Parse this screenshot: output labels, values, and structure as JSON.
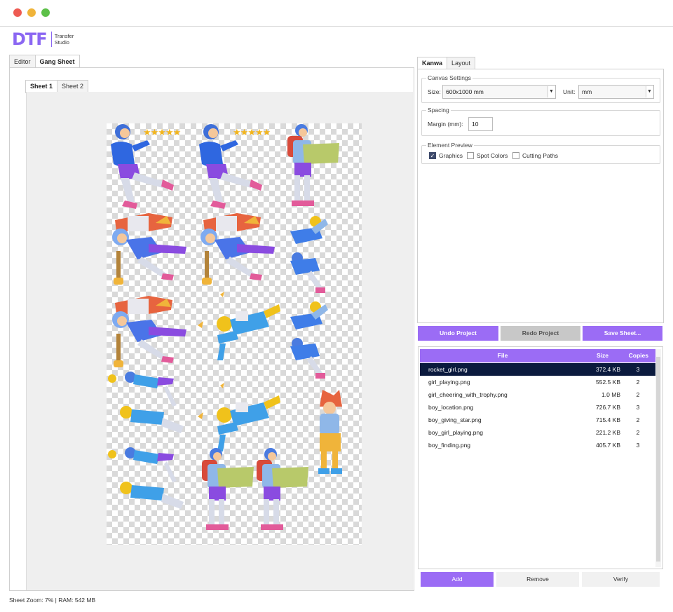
{
  "window": {
    "controls": [
      {
        "name": "close",
        "color": "#ee5b52"
      },
      {
        "name": "minimize",
        "color": "#f0b43a"
      },
      {
        "name": "maximize",
        "color": "#5cc048"
      }
    ]
  },
  "logo": {
    "mark": "DTF",
    "sub_line1": "Transfer",
    "sub_line2": "Studio",
    "color": "#8b67f2"
  },
  "main_tabs": [
    {
      "label": "Editor"
    },
    {
      "label": "Gang Sheet",
      "active": true
    }
  ],
  "sheet_tabs": [
    {
      "label": "Sheet 1",
      "active": true
    },
    {
      "label": "Sheet 2"
    }
  ],
  "canvas": {
    "stars": "★★★★★",
    "figures": [
      "boy-giving-star",
      "boy-giving-star",
      "boy-location",
      "rocket-girl",
      "rocket-girl",
      "girl-playing",
      "rocket-girl",
      "boy-finding",
      "girl-playing",
      "boy-girl-playing",
      "boy-finding",
      "girl-cheering-with-trophy",
      "boy-girl-playing",
      "boy-location",
      "boy-location",
      "rocket-girl"
    ]
  },
  "right_tabs": [
    {
      "label": "Kanwa",
      "active": true
    },
    {
      "label": "Layout"
    }
  ],
  "canvas_settings": {
    "title": "Canvas Settings",
    "size_label": "Size:",
    "size_value": "600x1000 mm",
    "unit_label": "Unit:",
    "unit_value": "mm"
  },
  "spacing": {
    "title": "Spacing",
    "margin_label": "Margin (mm):",
    "margin_value": "10"
  },
  "element_preview": {
    "title": "Element Preview",
    "options": [
      {
        "label": "Graphics",
        "checked": true
      },
      {
        "label": "Spot Colors",
        "checked": false
      },
      {
        "label": "Cutting Paths",
        "checked": false
      }
    ]
  },
  "actions": {
    "undo": "Undo Project",
    "redo": "Redo Project",
    "save": "Save Sheet..."
  },
  "file_list": {
    "headers": {
      "file": "File",
      "size": "Size",
      "copies": "Copies"
    },
    "rows": [
      {
        "file": "rocket_girl.png",
        "size": "372.4 KB",
        "copies": "3",
        "selected": true
      },
      {
        "file": "girl_playing.png",
        "size": "552.5 KB",
        "copies": "2"
      },
      {
        "file": "girl_cheering_with_trophy.png",
        "size": "1.0 MB",
        "copies": "2"
      },
      {
        "file": "boy_location.png",
        "size": "726.7 KB",
        "copies": "3"
      },
      {
        "file": "boy_giving_star.png",
        "size": "715.4 KB",
        "copies": "2"
      },
      {
        "file": "boy_girl_playing.png",
        "size": "221.2 KB",
        "copies": "2"
      },
      {
        "file": "boy_finding.png",
        "size": "405.7 KB",
        "copies": "3"
      }
    ]
  },
  "list_buttons": {
    "add": "Add",
    "remove": "Remove",
    "verify": "Verify"
  },
  "status_bar": {
    "text": "Sheet Zoom: 7% | RAM: 542 MB"
  }
}
